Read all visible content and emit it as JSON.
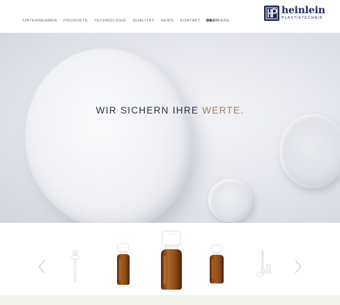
{
  "nav": {
    "items": [
      "UNTERNEHMEN",
      "PRODUKTE",
      "TECHNOLOGIE",
      "QUALITÄT",
      "NEWS",
      "KONTAKT",
      "KARRIERE"
    ],
    "lang_active": "DE",
    "lang_sep": "|",
    "lang_other": "EN"
  },
  "logo": {
    "mark": "HP",
    "name": "heinlein",
    "sub": "PLASTIKTECHNIK"
  },
  "hero": {
    "title_main": "WIR SICHERN IHRE ",
    "title_accent": "WERTE",
    "title_end": "."
  },
  "carousel": {
    "items": [
      "dropper-pipette",
      "amber-bottle-small-left",
      "amber-bottle-large",
      "amber-bottle-small-right",
      "caps-and-spatula"
    ]
  },
  "colors": {
    "brand_navy": "#1f2a5a",
    "accent_bronze": "#a47b57",
    "amber": "#8a4a16"
  },
  "icons": [
    "chevron-left-icon",
    "chevron-right-icon"
  ]
}
